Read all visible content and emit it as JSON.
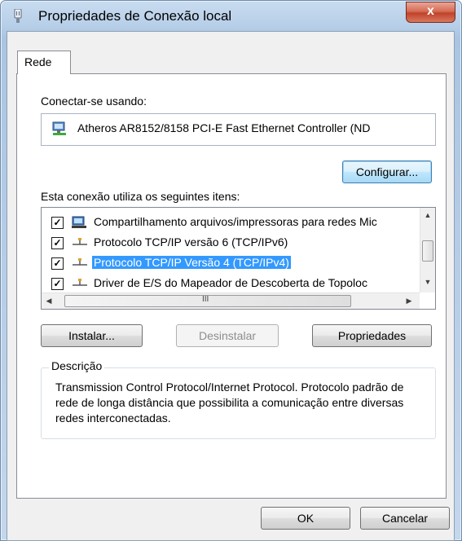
{
  "window": {
    "title": "Propriedades de Conexão local",
    "close_label": "x"
  },
  "tabs": [
    {
      "label": "Rede"
    }
  ],
  "connect": {
    "label": "Conectar-se usando:",
    "adapter_name": "Atheros AR8152/8158 PCI-E Fast Ethernet Controller (ND",
    "configure_label": "Configurar..."
  },
  "items_label": "Esta conexão utiliza os seguintes itens:",
  "items": [
    {
      "label": "Compartilhamento arquivos/impressoras para redes Mic",
      "checked": true,
      "selected": false,
      "icon": "network-service-icon"
    },
    {
      "label": "Protocolo TCP/IP versão 6 (TCP/IPv6)",
      "checked": true,
      "selected": false,
      "icon": "protocol-icon"
    },
    {
      "label": "Protocolo TCP/IP Versão 4 (TCP/IPv4)",
      "checked": true,
      "selected": true,
      "icon": "protocol-icon"
    },
    {
      "label": "Driver de E/S do Mapeador de Descoberta de Topoloc",
      "checked": true,
      "selected": false,
      "icon": "protocol-icon"
    }
  ],
  "scroll": {
    "h_grip": "III"
  },
  "actions": {
    "install": "Instalar...",
    "uninstall": "Desinstalar",
    "properties": "Propriedades"
  },
  "description": {
    "title": "Descrição",
    "text": "Transmission Control Protocol/Internet Protocol. Protocolo padrão de rede de longa distância que possibilita a comunicação entre diversas redes interconectadas."
  },
  "footer": {
    "ok": "OK",
    "cancel": "Cancelar"
  },
  "colors": {
    "selection": "#3399ff",
    "close_button": "#c0422a",
    "titlebar": "#b7cfe8"
  }
}
